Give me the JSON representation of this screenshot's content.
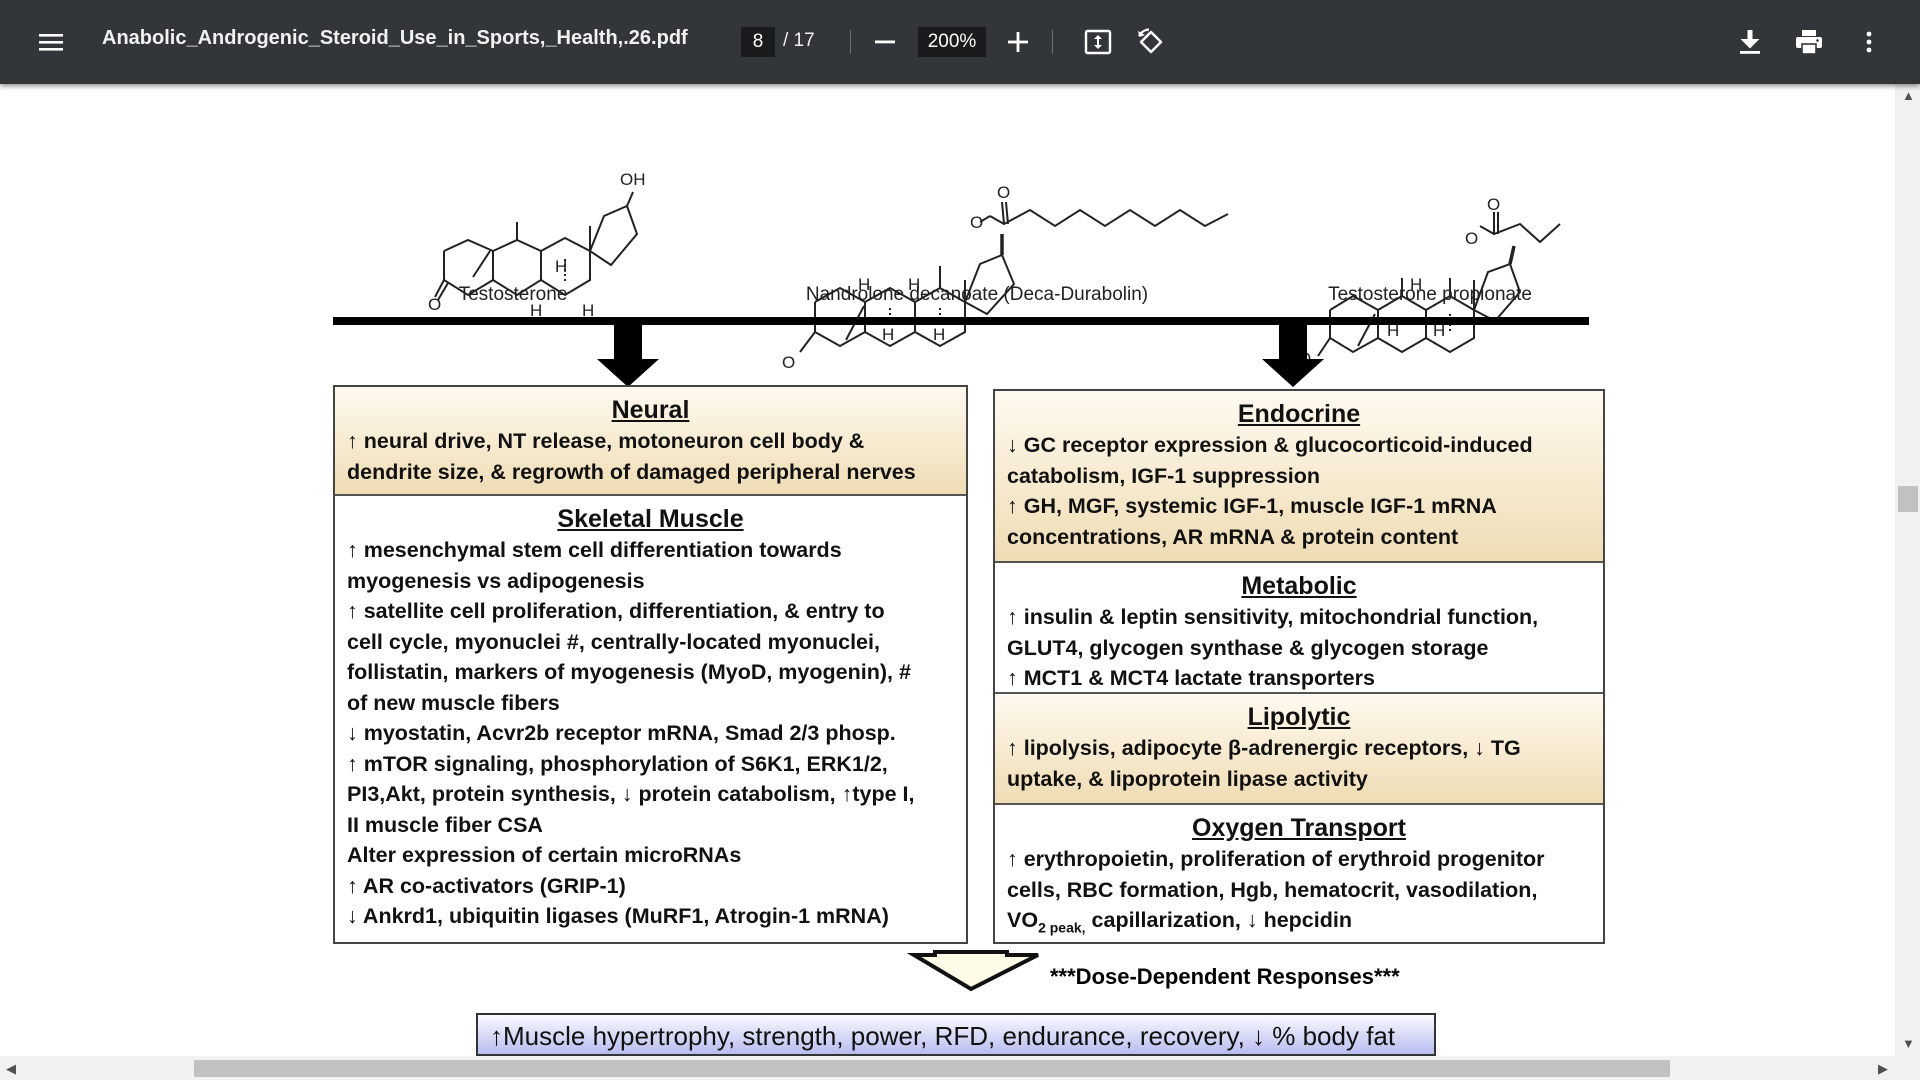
{
  "toolbar": {
    "menu_icon": "hamburger-menu-icon",
    "title": "Anabolic_Androgenic_Steroid_Use_in_Sports,_Health,.26.pdf",
    "current_page": "8",
    "total_pages": "/ 17",
    "zoom": "200%",
    "icons": [
      "zoom-out-icon",
      "zoom-in-icon",
      "fit-page-icon",
      "rotate-icon",
      "download-icon",
      "print-icon",
      "more-options-icon"
    ]
  },
  "figure": {
    "molecules": [
      "Testosterone",
      "Nandrolone decanoate (Deca-Durabolin)",
      "Testosterone propionate"
    ],
    "neural": {
      "title": "Neural",
      "lines": [
        "↑ neural drive, NT release, motoneuron cell body &",
        "dendrite size, & regrowth of damaged peripheral nerves"
      ]
    },
    "skeletal": {
      "title": "Skeletal Muscle",
      "lines": [
        "↑ mesenchymal stem cell differentiation towards",
        "myogenesis vs adipogenesis",
        "↑ satellite cell proliferation,  differentiation, & entry to",
        "cell cycle, myonuclei #, centrally-located myonuclei,",
        "follistatin, markers of myogenesis (MyoD, myogenin), #",
        "of new muscle fibers",
        "↓ myostatin, Acvr2b receptor mRNA, Smad 2/3 phosp.",
        "↑ mTOR signaling, phosphorylation of S6K1, ERK1/2,",
        "PI3,Akt, protein synthesis, ↓ protein catabolism, ↑type I,",
        "II muscle fiber CSA",
        "Alter expression of certain microRNAs",
        "↑ AR co-activators (GRIP-1)",
        "↓ Ankrd1, ubiquitin ligases (MuRF1, Atrogin-1 mRNA)"
      ]
    },
    "endocrine": {
      "title": "Endocrine",
      "lines": [
        "↓ GC receptor expression & glucocorticoid-induced",
        "catabolism, IGF-1 suppression",
        "↑ GH, MGF, systemic IGF-1, muscle IGF-1 mRNA",
        "concentrations, AR mRNA & protein content"
      ]
    },
    "metabolic": {
      "title": "Metabolic",
      "lines": [
        "↑ insulin & leptin sensitivity, mitochondrial function,",
        "GLUT4, glycogen synthase & glycogen storage",
        "↑ MCT1 & MCT4 lactate transporters"
      ]
    },
    "lipolytic": {
      "title": "Lipolytic",
      "lines": [
        "↑ lipolysis, adipocyte β-adrenergic receptors, ↓ TG",
        "uptake, & lipoprotein lipase activity"
      ]
    },
    "oxygen": {
      "title": "Oxygen Transport",
      "lines": [
        "↑ erythropoietin, proliferation of erythroid progenitor",
        "cells, RBC formation, Hgb, hematocrit, vasodilation,"
      ],
      "last_prefix": "VO",
      "last_sub": "2 peak,",
      "last_suffix": " capillarization, ↓ hepcidin"
    },
    "dose": "***Dose-Dependent Responses***",
    "result": "↑Muscle hypertrophy, strength, power, RFD, endurance, recovery, ↓ % body fat"
  }
}
